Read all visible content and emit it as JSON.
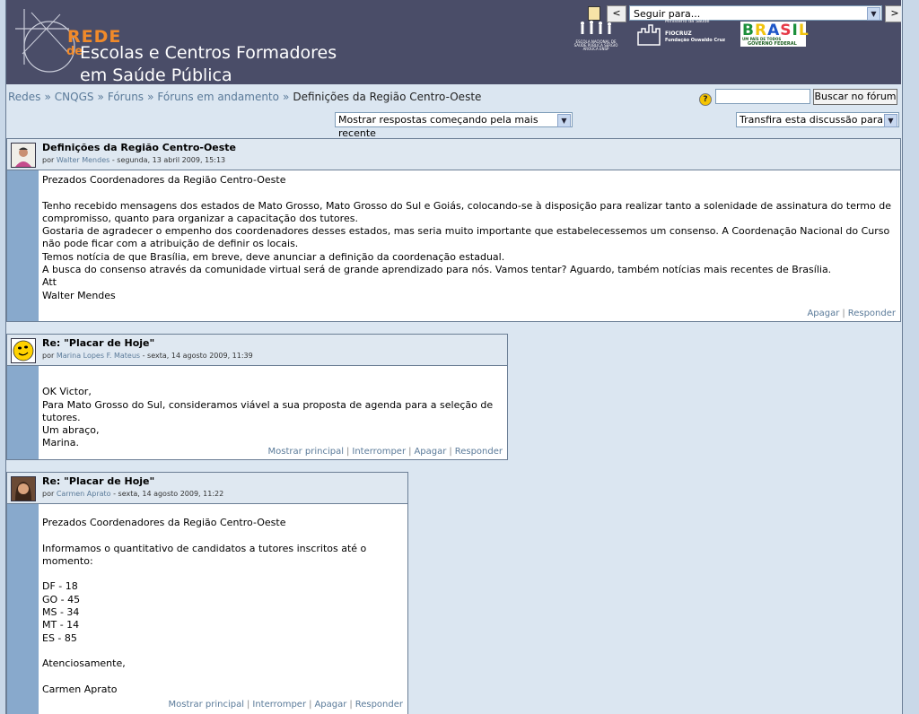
{
  "header": {
    "logo": {
      "rede": "REDE",
      "de": "de",
      "line1": "Escolas e Centros Formadores",
      "line2": "em Saúde Pública"
    },
    "nav": {
      "prev": "<",
      "jump_placeholder": "Seguir para...",
      "next": ">"
    },
    "orgs": {
      "ensp_text": "ESCOLA NACIONAL DE SAÚDE PÚBLICA SERGIO AROUCA ENSP",
      "fiocruz_ministry": "Ministério da Saúde",
      "fiocruz_name": "FIOCRUZ",
      "fiocruz_sub": "Fundação Oswaldo Cruz",
      "brasil_word": "BRASIL",
      "brasil_sub1": "UM PAÍS DE TODOS",
      "brasil_sub2": "GOVERNO FEDERAL",
      "brasil_colors": [
        "#1b8f3a",
        "#f1c40f",
        "#1e56c8",
        "#e63946",
        "#1b8f3a",
        "#f1c40f"
      ]
    }
  },
  "breadcrumb": {
    "items": [
      "Redes",
      "CNQGS",
      "Fóruns",
      "Fóruns em andamento"
    ],
    "separator": "»",
    "current": "Definições da Região Centro-Oeste"
  },
  "search": {
    "help": "?",
    "input_value": "",
    "button": "Buscar no fórum"
  },
  "controls": {
    "display_mode": "Mostrar respostas começando pela mais recente",
    "move_to": "Transfira esta discussão para ..."
  },
  "colors": {
    "header_bg": "#4a4d68",
    "accent_orange": "#f08a2a",
    "link": "#5a7a99",
    "left_bar": "#88a9cc",
    "page_bg": "#dbe6f1"
  },
  "posts": [
    {
      "subject": "Definições da Região Centro-Oeste",
      "by": "por",
      "author": "Walter Mendes",
      "date": "- segunda, 13 abril 2009, 15:13",
      "avatar": "person-avatar",
      "body": [
        "Prezados Coordenadores da Região Centro-Oeste",
        "",
        "Tenho recebido mensagens dos estados de Mato Grosso, Mato Grosso do Sul e Goiás, colocando-se à disposição para realizar tanto a solenidade de assinatura do termo de compromisso, quanto para organizar a capacitação dos tutores.",
        "Gostaria de agradecer o empenho dos coordenadores desses estados, mas seria muito importante que estabelecessemos um consenso. A Coordenação Nacional do Curso não pode ficar com a atribuição de definir os locais.",
        "Temos notícia de que Brasília, em breve, deve anunciar a definição da coordenação estadual.",
        "A busca do consenso através da comunidade virtual será de grande aprendizado para nós. Vamos tentar? Aguardo, também notícias mais recentes de Brasília.",
        "Att",
        "Walter Mendes"
      ],
      "commands": [
        "Apagar",
        "Responder"
      ]
    },
    {
      "subject": "Re: \"Placar de Hoje\"",
      "by": "por",
      "author": "Marina Lopes F. Mateus",
      "date": "- sexta, 14 agosto 2009, 11:39",
      "avatar": "smiley-avatar",
      "body": [
        "",
        "OK Victor,",
        "Para Mato Grosso do Sul, consideramos viável a sua proposta de agenda para a seleção de tutores.",
        "Um abraço,",
        "Marina."
      ],
      "commands": [
        "Mostrar principal",
        "Interromper",
        "Apagar",
        "Responder"
      ]
    },
    {
      "subject": "Re: \"Placar de Hoje\"",
      "by": "por",
      "author": "Carmen Aprato",
      "date": "- sexta, 14 agosto 2009, 11:22",
      "avatar": "person-avatar",
      "body": [
        "Prezados Coordenadores da Região Centro-Oeste",
        "",
        "Informamos o quantitativo de candidatos a tutores inscritos até o momento:",
        "",
        "DF - 18",
        "GO - 45",
        "MS - 34",
        "MT - 14",
        "ES - 85",
        "",
        "Atenciosamente,",
        "",
        "Carmen Aprato"
      ],
      "commands": [
        "Mostrar principal",
        "Interromper",
        "Apagar",
        "Responder"
      ]
    }
  ]
}
